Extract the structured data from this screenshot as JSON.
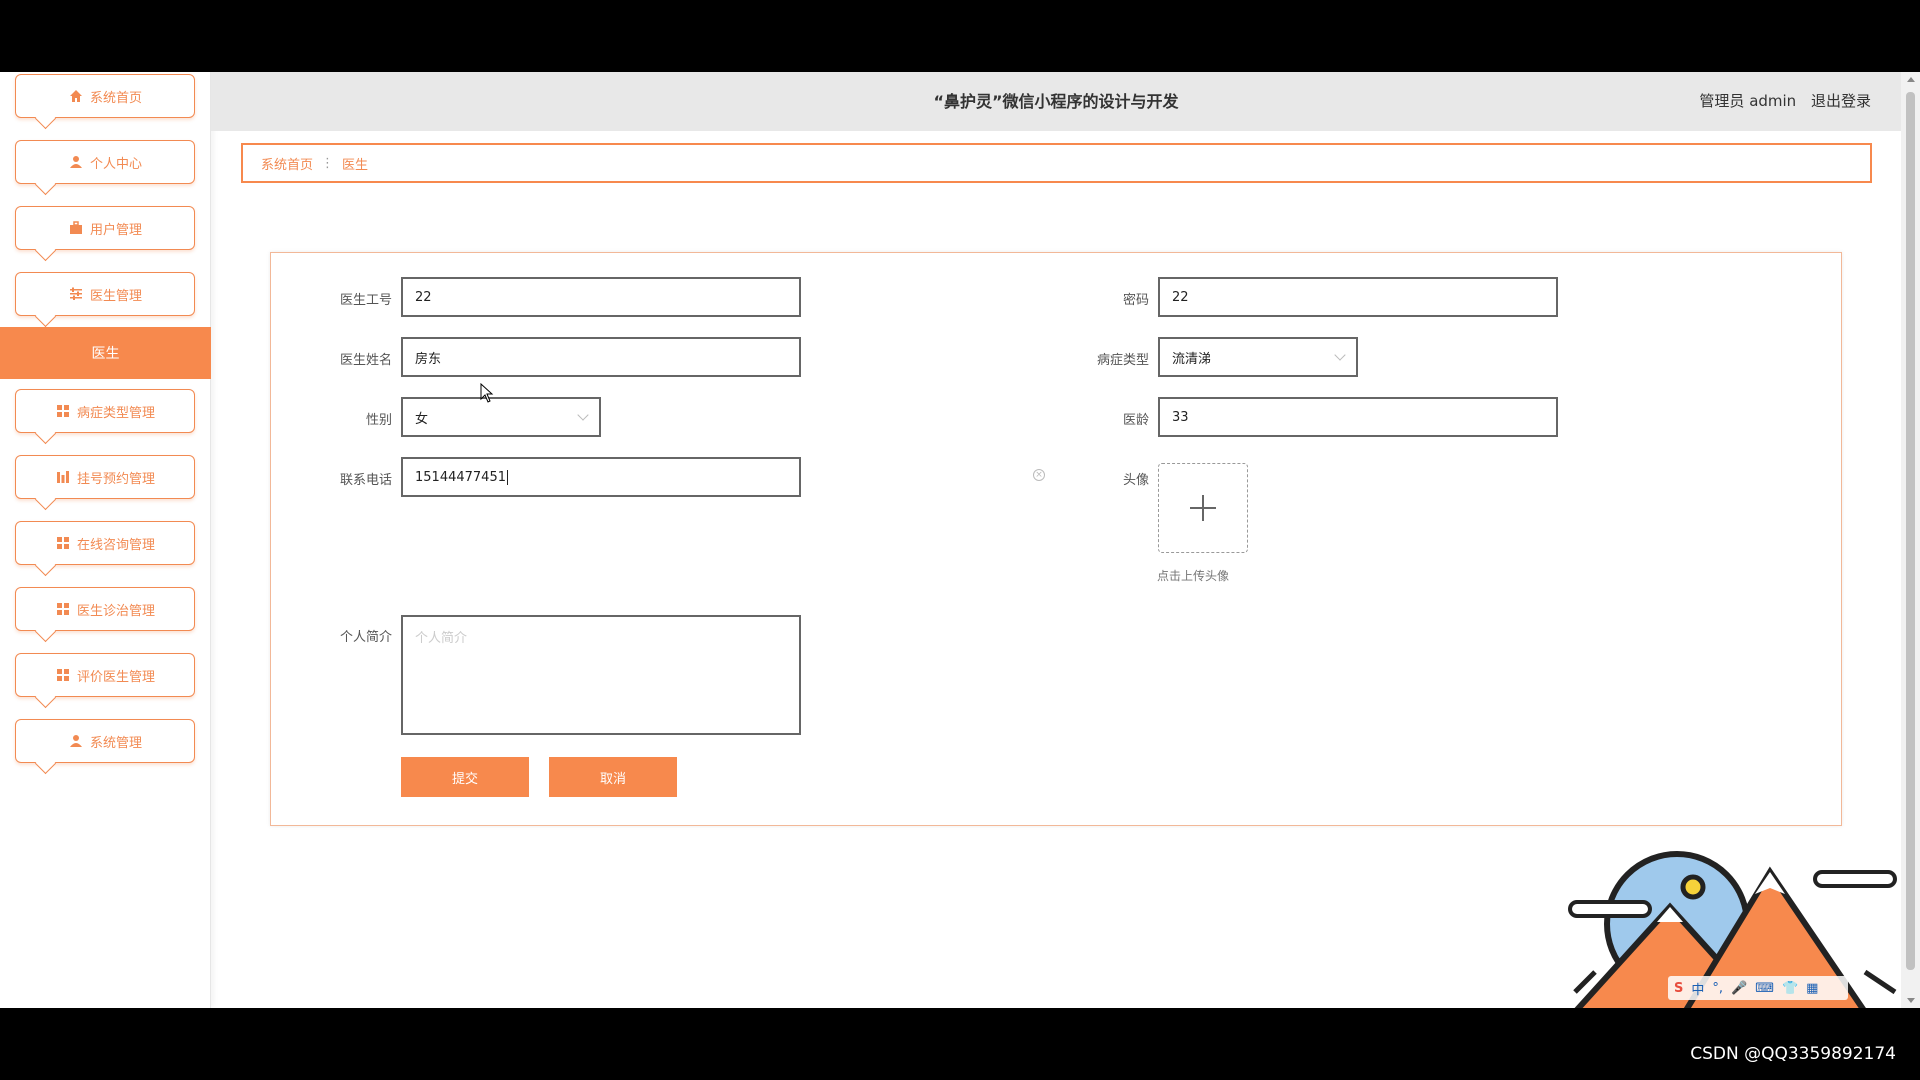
{
  "app": {
    "title": "“鼻护灵”微信小程序的设计与开发",
    "user_label": "管理员 admin",
    "logout_label": "退出登录"
  },
  "sidebar": {
    "items": [
      {
        "label": "系统首页",
        "icon": "home-icon"
      },
      {
        "label": "个人中心",
        "icon": "user-icon"
      },
      {
        "label": "用户管理",
        "icon": "briefcase-icon"
      },
      {
        "label": "医生管理",
        "icon": "sliders-icon"
      }
    ],
    "active_sub": "医生",
    "items2": [
      {
        "label": "病症类型管理",
        "icon": "grid-icon"
      },
      {
        "label": "挂号预约管理",
        "icon": "bar-chart-icon"
      },
      {
        "label": "在线咨询管理",
        "icon": "grid-icon"
      },
      {
        "label": "医生诊治管理",
        "icon": "grid-icon"
      },
      {
        "label": "评价医生管理",
        "icon": "grid-icon"
      },
      {
        "label": "系统管理",
        "icon": "user-icon"
      }
    ]
  },
  "breadcrumb": {
    "home": "系统首页",
    "current": "医生"
  },
  "form": {
    "doctor_id": {
      "label": "医生工号",
      "value": "22"
    },
    "password": {
      "label": "密码",
      "value": "22"
    },
    "doctor_name": {
      "label": "医生姓名",
      "value": "房东"
    },
    "disease_type": {
      "label": "病症类型",
      "value": "流清涕"
    },
    "gender": {
      "label": "性别",
      "value": "女"
    },
    "years": {
      "label": "医龄",
      "value": "33"
    },
    "phone": {
      "label": "联系电话",
      "value": "15144477451"
    },
    "avatar": {
      "label": "头像",
      "hint": "点击上传头像"
    },
    "bio": {
      "label": "个人简介",
      "placeholder": "个人简介"
    },
    "submit_label": "提交",
    "cancel_label": "取消"
  },
  "ime": {
    "logo": "S",
    "mode": "中"
  },
  "watermark": "CSDN @QQ3359892174",
  "colors": {
    "accent": "#f7894d",
    "accent_text": "#f28a52"
  }
}
